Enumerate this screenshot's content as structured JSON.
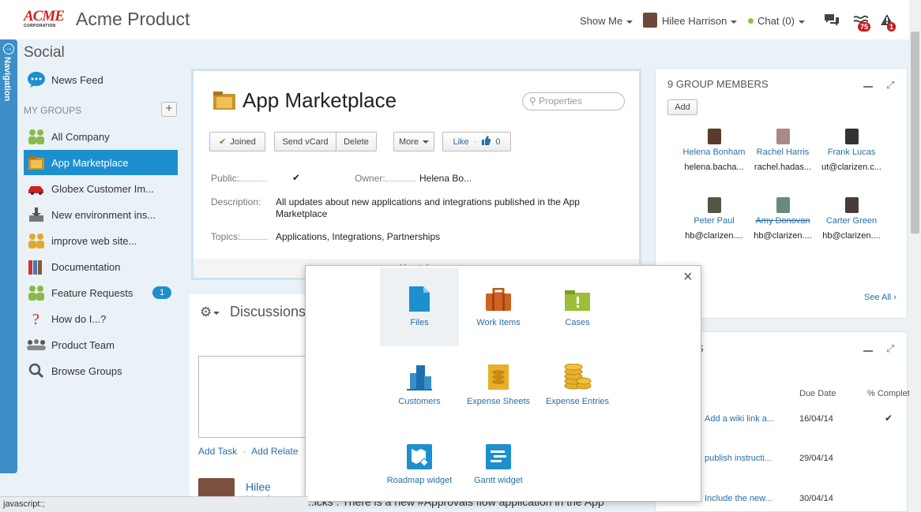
{
  "header": {
    "logo_main": "ACME",
    "logo_sub": "CORPORATION",
    "app_title": "Acme Product",
    "show_me": "Show Me",
    "user_name": "Hilee Harrison",
    "chat": "Chat (0)",
    "feed_badge": "75",
    "alert_badge": "1"
  },
  "nav": {
    "label": "Navigation"
  },
  "sidebar": {
    "title": "Social",
    "news_feed": "News Feed",
    "my_groups": "MY GROUPS",
    "add_label": "+",
    "groups": [
      {
        "label": "All Company",
        "icon": "people-icon"
      },
      {
        "label": "App Marketplace",
        "icon": "folder-icon"
      },
      {
        "label": "Globex Customer Im...",
        "icon": "car-icon"
      },
      {
        "label": "New environment ins...",
        "icon": "download-icon"
      },
      {
        "label": "improve web site...",
        "icon": "people-icon"
      },
      {
        "label": "Documentation",
        "icon": "books-icon"
      },
      {
        "label": "Feature Requests",
        "icon": "people-icon",
        "badge": "1"
      },
      {
        "label": "How do I...?",
        "icon": "question-icon"
      },
      {
        "label": "Product Team",
        "icon": "team-icon"
      },
      {
        "label": "Browse Groups",
        "icon": "search-icon"
      }
    ]
  },
  "group": {
    "title": "App Marketplace",
    "search_placeholder": "Properties",
    "buttons": {
      "joined": "Joined",
      "send_vcard": "Send vCard",
      "delete": "Delete",
      "more": "More",
      "like": "Like",
      "like_sep": "·",
      "like_count": "0"
    },
    "public_label": "Public:",
    "public_value": "✔",
    "owner_label": "Owner:",
    "owner_value": "Helena Bo...",
    "description_label": "Description:",
    "description_value": "All updates about new applications and integrations published in the App Marketplace",
    "topics_label": "Topics:",
    "topics_value": "Applications, Integrations, Partnerships",
    "more_info": "More info"
  },
  "discussions": {
    "title": "Discussions",
    "add_task": "Add Task",
    "sep": "·",
    "add_related": "Add Relate",
    "post_author": "Hilee Harrison",
    "post_text": "...icks : There is a new #Approvals flow application in the App"
  },
  "members": {
    "title": "9 GROUP MEMBERS",
    "add": "Add",
    "see_all": "See All",
    "list": [
      {
        "name": "Helena Bonham",
        "email": "helena.bacha..."
      },
      {
        "name": "Rachel Harris",
        "email": "rachel.hadas..."
      },
      {
        "name": "Frank Lucas",
        "email": "ut@clarizen.c..."
      },
      {
        "name": "Peter Paul",
        "email": "hb@clarizen...."
      },
      {
        "name": "Amy Donovan",
        "email": "hb@clarizen...."
      },
      {
        "name": "Carter Green",
        "email": "hb@clarizen...."
      }
    ]
  },
  "tasks": {
    "title": "S",
    "col_due": "Due Date",
    "col_complete": "% Complet",
    "rows": [
      {
        "name": "Add a wiki link a...",
        "due": "16/04/14",
        "done": "✔"
      },
      {
        "name": "publish instructi...",
        "due": "29/04/14",
        "done": ""
      },
      {
        "name": "Include the new...",
        "due": "30/04/14",
        "done": ""
      }
    ]
  },
  "popup": {
    "close": "×",
    "items": [
      {
        "label": "Files",
        "icon": "file-icon"
      },
      {
        "label": "Work Items",
        "icon": "briefcase-icon"
      },
      {
        "label": "Cases",
        "icon": "case-folder-icon"
      },
      {
        "label": "Customers",
        "icon": "buildings-icon"
      },
      {
        "label": "Expense Sheets",
        "icon": "expense-sheet-icon"
      },
      {
        "label": "Expense Entries",
        "icon": "coins-icon"
      },
      {
        "label": "Roadmap widget",
        "icon": "roadmap-icon"
      },
      {
        "label": "Gantt widget",
        "icon": "gantt-icon"
      }
    ]
  },
  "status_bar": "javascript:;",
  "colors": {
    "accent": "#1d8fce",
    "brand_red": "#d42020",
    "link": "#2a6fa8"
  }
}
